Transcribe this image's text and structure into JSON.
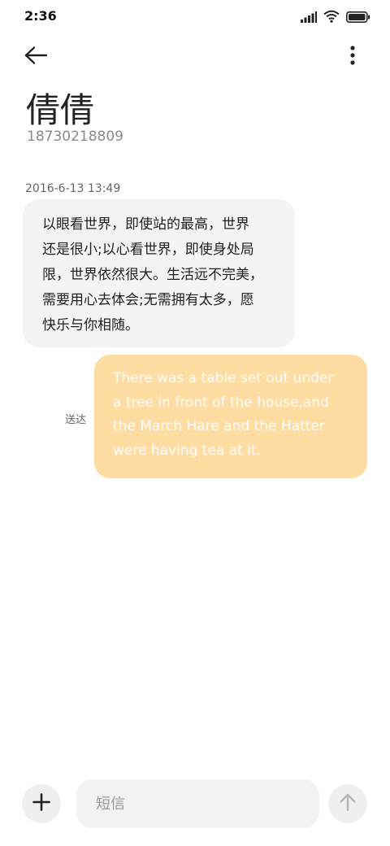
{
  "status_bar": {
    "time": "2:36",
    "icons": [
      "signal-icon",
      "wifi-icon",
      "battery-icon"
    ]
  },
  "nav": {
    "back_icon": "back-arrow-icon",
    "more_icon": "more-vertical-icon"
  },
  "contact": {
    "name": "倩倩",
    "number": "18730218809"
  },
  "conversation": {
    "timestamp": "2016-6-13 13:49",
    "messages": [
      {
        "direction": "incoming",
        "lines": [
          "以眼看世界，即使站的最高，世界",
          "还是很小;以心看世界，即使身处局",
          "限，世界依然很大。生活远不完美，",
          "需要用心去体会;无需拥有太多，愿",
          "快乐与你相随。"
        ]
      },
      {
        "direction": "outgoing",
        "status": "送达",
        "lines": [
          "There was a table set out under",
          "a tree in front of the house,and",
          "the March Hare and the Hatter",
          "were having tea at it."
        ]
      }
    ]
  },
  "composer": {
    "attach_icon": "plus-icon",
    "placeholder": "短信",
    "value": "",
    "send_icon": "arrow-up-icon"
  },
  "colors": {
    "incoming_bubble": "#f4f4f4",
    "outgoing_bubble": "#ffdca1",
    "outgoing_text": "#ffffff",
    "muted_text": "#8a8a8a"
  }
}
